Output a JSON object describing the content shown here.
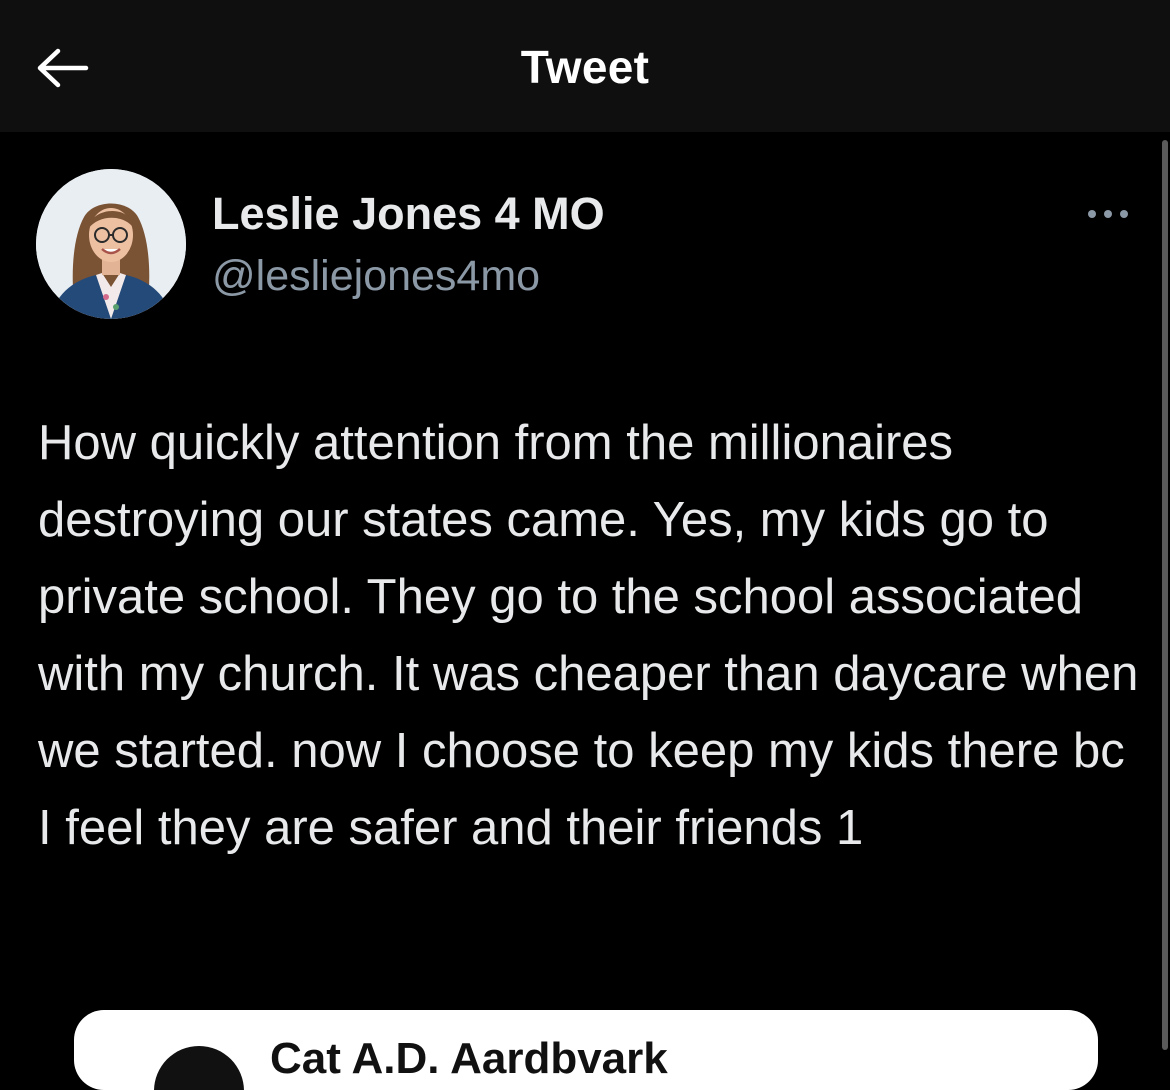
{
  "header": {
    "title": "Tweet",
    "back_icon": "arrow-left-icon"
  },
  "tweet": {
    "author_name": "Leslie Jones 4 MO",
    "author_handle": "@lesliejones4mo",
    "more_icon": "more-horizontal-icon",
    "text": "How quickly attention from the millionaires destroying our states came. Yes, my kids go to private school. They go to the school associated with my church. It was cheaper than daycare when we started. now I choose to keep my kids there bc I feel they are safer and their friends 1"
  },
  "quote": {
    "author_name_partial": "Cat A.D. Aardbvark"
  },
  "colors": {
    "background": "#000000",
    "header_bg": "#0f0f0f",
    "text_primary": "#e7e9ea",
    "text_secondary": "#8b98a5"
  }
}
